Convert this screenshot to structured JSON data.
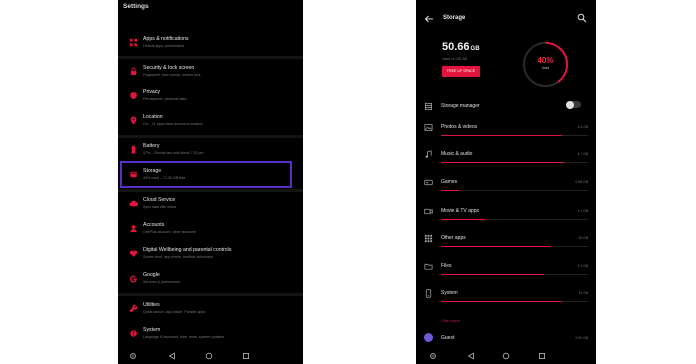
{
  "colors": {
    "accent": "#e2143e",
    "highlight": "#5a2fc8",
    "background": "#000000"
  },
  "settings": {
    "title": "Settings",
    "items": [
      {
        "title": "Apps & notifications",
        "subtitle": "Default apps, permissions",
        "icon": "apps-icon"
      },
      {
        "title": "Security & lock screen",
        "subtitle": "Fingerprint, face unlock, screen lock",
        "icon": "lock-icon"
      },
      {
        "title": "Privacy",
        "subtitle": "Permissions, personal data",
        "icon": "privacy-icon"
      },
      {
        "title": "Location",
        "subtitle": "On – 21 apps have access to location",
        "icon": "location-icon"
      },
      {
        "title": "Battery",
        "subtitle": "57% – Should last until about 7:30 pm",
        "icon": "battery-icon"
      },
      {
        "title": "Storage",
        "subtitle": "40% used – 71.35 GB free",
        "icon": "storage-icon"
      },
      {
        "title": "Cloud Service",
        "subtitle": "Sync data with cloud",
        "icon": "cloud-icon"
      },
      {
        "title": "Accounts",
        "subtitle": "OnePlus account, other accounts",
        "icon": "account-icon"
      },
      {
        "title": "Digital Wellbeing and parental controls",
        "subtitle": "Screen time, app timers, bedtime schedules",
        "icon": "wellbeing-icon"
      },
      {
        "title": "Google",
        "subtitle": "Services & preferences",
        "icon": "google-icon"
      },
      {
        "title": "Utilities",
        "subtitle": "Quick launch, App locker, Parallel apps",
        "icon": "utilities-icon"
      },
      {
        "title": "System",
        "subtitle": "Language & keyboard, time, reset, system updates",
        "icon": "system-icon"
      }
    ]
  },
  "storage": {
    "title": "Storage",
    "used_value": "50.66",
    "used_unit": "GB",
    "used_sub": "Used of 128 GB",
    "free_button": "FREE UP SPACE",
    "used_percent_label": "40%",
    "used_fraction": 0.4,
    "used_label": "Used",
    "manager_label": "Storage manager",
    "manager_enabled": false,
    "categories": [
      {
        "label": "Photos & videos",
        "size": "4.4 GB",
        "fraction": 0.82,
        "icon": "photos-icon"
      },
      {
        "label": "Music & audio",
        "size": "4.7 GB",
        "fraction": 0.84,
        "icon": "music-icon"
      },
      {
        "label": "Games",
        "size": "0.08 GB",
        "fraction": 0.12,
        "icon": "games-icon"
      },
      {
        "label": "Movie & TV apps",
        "size": "1.1 GB",
        "fraction": 0.3,
        "icon": "movie-icon"
      },
      {
        "label": "Other apps",
        "size": "20 GB",
        "fraction": 0.75,
        "icon": "apps-grid-icon"
      },
      {
        "label": "Files",
        "size": "2.1 GB",
        "fraction": 0.7,
        "icon": "folder-icon"
      },
      {
        "label": "System",
        "size": "14 GB",
        "fraction": 0.82,
        "icon": "system-phone-icon"
      }
    ],
    "section_label": "Other users",
    "guest_label": "Guest",
    "guest_size": "0.00 GB"
  }
}
